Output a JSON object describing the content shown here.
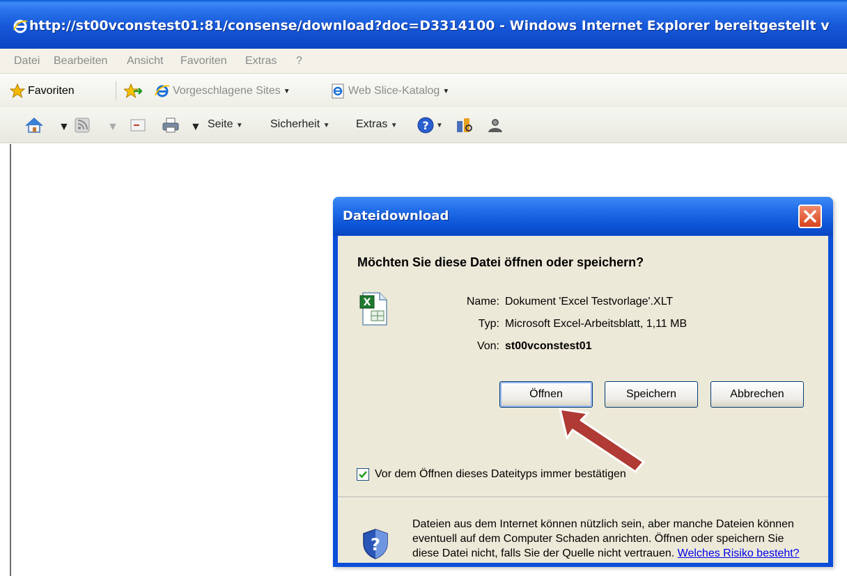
{
  "window": {
    "title": "http://st00vconstest01:81/consense/download?doc=D3314100 - Windows Internet Explorer bereitgestellt v"
  },
  "menubar": {
    "items": [
      "Datei",
      "Bearbeiten",
      "Ansicht",
      "Favoriten",
      "Extras",
      "?"
    ]
  },
  "favbar": {
    "favorites_label": "Favoriten",
    "suggested_sites": "Vorgeschlagene Sites",
    "web_slice": "Web Slice-Katalog"
  },
  "cmdbar": {
    "page": "Seite",
    "security": "Sicherheit",
    "extras": "Extras"
  },
  "dialog": {
    "title": "Dateidownload",
    "question": "Möchten Sie diese Datei öffnen oder speichern?",
    "name_label": "Name:",
    "name_value": "Dokument 'Excel Testvorlage'.XLT",
    "type_label": "Typ:",
    "type_value": "Microsoft Excel-Arbeitsblatt, 1,11 MB",
    "from_label": "Von:",
    "from_value": "st00vconstest01",
    "open_button": "Öffnen",
    "save_button": "Speichern",
    "cancel_button": "Abbrechen",
    "checkbox_label": "Vor dem Öffnen dieses Dateityps immer bestätigen",
    "checkbox_checked": true,
    "warning_text": "Dateien aus dem Internet können nützlich sein, aber manche Dateien können eventuell auf dem Computer Schaden anrichten. Öffnen oder speichern Sie diese Datei nicht, falls Sie der Quelle nicht vertrauen.",
    "warning_link": "Welches Risiko besteht?"
  },
  "colors": {
    "titlebar_blue": "#0b4ed9",
    "dialog_body": "#ece9d8",
    "close_red": "#d8431c",
    "annotation_arrow": "#b03a34"
  }
}
